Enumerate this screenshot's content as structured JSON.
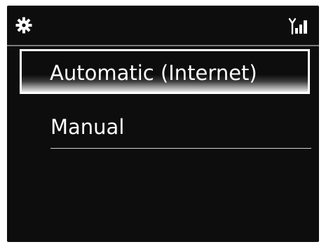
{
  "status_bar": {
    "left_icon": "gear-icon",
    "right_icon": "signal-strength-icon"
  },
  "menu": {
    "items": [
      {
        "label": "Automatic (Internet)",
        "selected": true
      },
      {
        "label": "Manual",
        "selected": false
      }
    ]
  },
  "colors": {
    "background": "#0d0d0d",
    "text": "#ffffff",
    "highlight": "#ffffff"
  }
}
